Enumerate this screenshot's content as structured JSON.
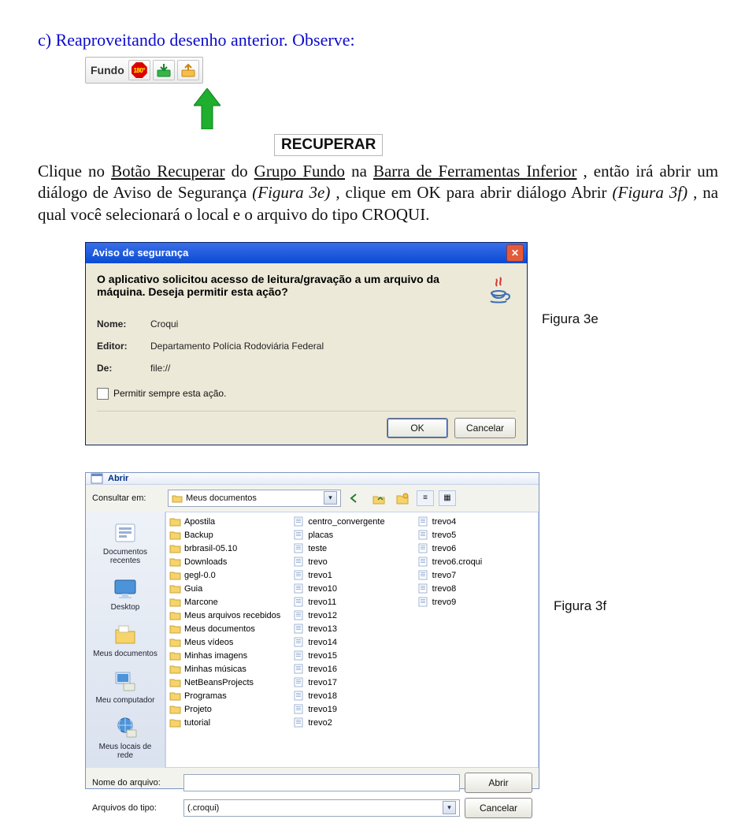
{
  "title_line": "c)  Reaproveitando desenho anterior. Observe:",
  "toolbar": {
    "label": "Fundo",
    "rotate_label": "180°"
  },
  "callout": {
    "label": "RECUPERAR"
  },
  "para_pre": "Clique no ",
  "para_u1": "Botão Recuperar",
  "para_mid1": " do ",
  "para_u2": "Grupo Fundo",
  "para_mid2": " na ",
  "para_u3": "Barra de Ferramentas Inferior",
  "para_mid3": ", então irá abrir um diálogo de Aviso de Segurança",
  "para_i1": "(Figura 3e)",
  "para_mid4": ", clique em OK para abrir diálogo Abrir",
  "para_i2": "(Figura 3f)",
  "para_end": ", na qual você selecionará o local e o arquivo do tipo CROQUI.",
  "dlg3e": {
    "title": "Aviso de segurança",
    "message": "O aplicativo solicitou acesso de leitura/gravação a um arquivo da máquina. Deseja permitir esta ação?",
    "name_k": "Nome:",
    "name_v": "Croqui",
    "editor_k": "Editor:",
    "editor_v": "Departamento Polícia Rodoviária Federal",
    "from_k": "De:",
    "from_v": "file://",
    "checkbox": "Permitir sempre esta ação.",
    "ok": "OK",
    "cancel": "Cancelar"
  },
  "caption_3e": "Figura 3e",
  "dlg3f": {
    "title": "Abrir",
    "lookin_label": "Consultar em:",
    "lookin_value": "Meus documentos",
    "places": {
      "recent": "Documentos recentes",
      "desktop": "Desktop",
      "mydocs": "Meus documentos",
      "mypc": "Meu computador",
      "mynet": "Meus locais de rede"
    },
    "col1": [
      "Apostila",
      "Backup",
      "brbrasil-05.10",
      "Downloads",
      "gegl-0.0",
      "Guia",
      "Marcone",
      "Meus arquivos recebidos",
      "Meus documentos",
      "Meus vídeos",
      "Minhas imagens",
      "Minhas músicas",
      "NetBeansProjects",
      "Programas",
      "Projeto",
      "tutorial"
    ],
    "col1_types": [
      "folder",
      "folder",
      "folder",
      "folder",
      "folder",
      "folder",
      "folder",
      "folder",
      "folder",
      "folder",
      "folder",
      "folder",
      "folder",
      "folder",
      "folder",
      "folder"
    ],
    "col2": [
      "centro_convergente",
      "placas",
      "teste",
      "trevo",
      "trevo1",
      "trevo10",
      "trevo11",
      "trevo12",
      "trevo13",
      "trevo14",
      "trevo15",
      "trevo16",
      "trevo17",
      "trevo18",
      "trevo19",
      "trevo2"
    ],
    "col2_types": [
      "file",
      "file",
      "file",
      "file",
      "file",
      "file",
      "file",
      "file",
      "file",
      "file",
      "file",
      "file",
      "file",
      "file",
      "file",
      "file"
    ],
    "col3": [
      "trevo4",
      "trevo5",
      "trevo6",
      "trevo6.croqui",
      "trevo7",
      "trevo8",
      "trevo9"
    ],
    "col3_types": [
      "file",
      "file",
      "file",
      "file",
      "file",
      "file",
      "file"
    ],
    "filename_label": "Nome do arquivo:",
    "filename_value": "",
    "filetype_label": "Arquivos do tipo:",
    "filetype_value": "(.croqui)",
    "open": "Abrir",
    "cancel": "Cancelar"
  },
  "caption_3f": "Figura 3f"
}
